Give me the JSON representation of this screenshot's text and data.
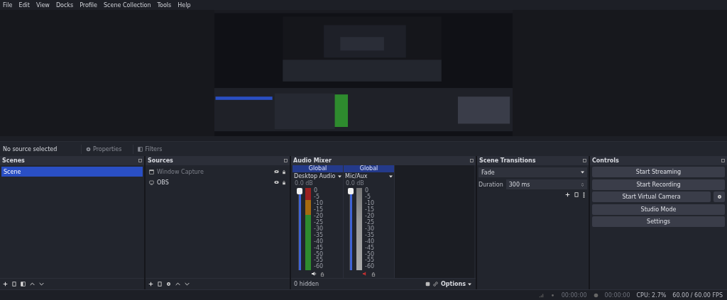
{
  "menu": [
    "File",
    "Edit",
    "View",
    "Docks",
    "Profile",
    "Scene Collection",
    "Tools",
    "Help"
  ],
  "context_bar": {
    "label": "No source selected",
    "buttons": [
      {
        "label": "Properties",
        "kind": "gear"
      },
      {
        "label": "Filters",
        "kind": "filter"
      }
    ]
  },
  "scenes": {
    "title": "Scenes",
    "items": [
      {
        "name": "Scene",
        "selected": true
      }
    ]
  },
  "sources": {
    "title": "Sources",
    "items": [
      {
        "name": "Window Capture",
        "kind": "window",
        "visible": false
      },
      {
        "name": "OBS",
        "kind": "display",
        "visible": true
      }
    ]
  },
  "audio_mixer": {
    "title": "Audio Mixer",
    "channels": [
      {
        "scope": "Global",
        "name": "Desktop Audio",
        "reading": "0.0 dB",
        "level": 1,
        "muted": false,
        "scale": [
          "0",
          "-5",
          "-10",
          "-15",
          "-20",
          "-25",
          "-30",
          "-35",
          "-40",
          "-45",
          "-50",
          "-55",
          "-60"
        ]
      },
      {
        "scope": "Global",
        "name": "Mic/Aux",
        "reading": "0.0 dB",
        "level": 1,
        "muted": true,
        "scale": [
          "0",
          "-5",
          "-10",
          "-15",
          "-20",
          "-25",
          "-30",
          "-35",
          "-40",
          "-45",
          "-50",
          "-55",
          "-60"
        ]
      }
    ],
    "hidden": "0 hidden",
    "options": "Options"
  },
  "scene_transitions": {
    "title": "Scene Transitions",
    "transition": "Fade",
    "duration_label": "Duration",
    "duration": "300 ms"
  },
  "controls": {
    "title": "Controls",
    "buttons": [
      {
        "label": "Start Streaming",
        "settings": false
      },
      {
        "label": "Start Recording",
        "settings": false
      },
      {
        "label": "Start Virtual Camera",
        "settings": true
      },
      {
        "label": "Studio Mode",
        "settings": false
      },
      {
        "label": "Settings",
        "settings": false
      }
    ]
  },
  "status_bar": {
    "stream_time": "00:00:00",
    "record_time": "00:00:00",
    "cpu": "CPU: 2.7%",
    "fps": "60.00 / 60.00 FPS"
  }
}
